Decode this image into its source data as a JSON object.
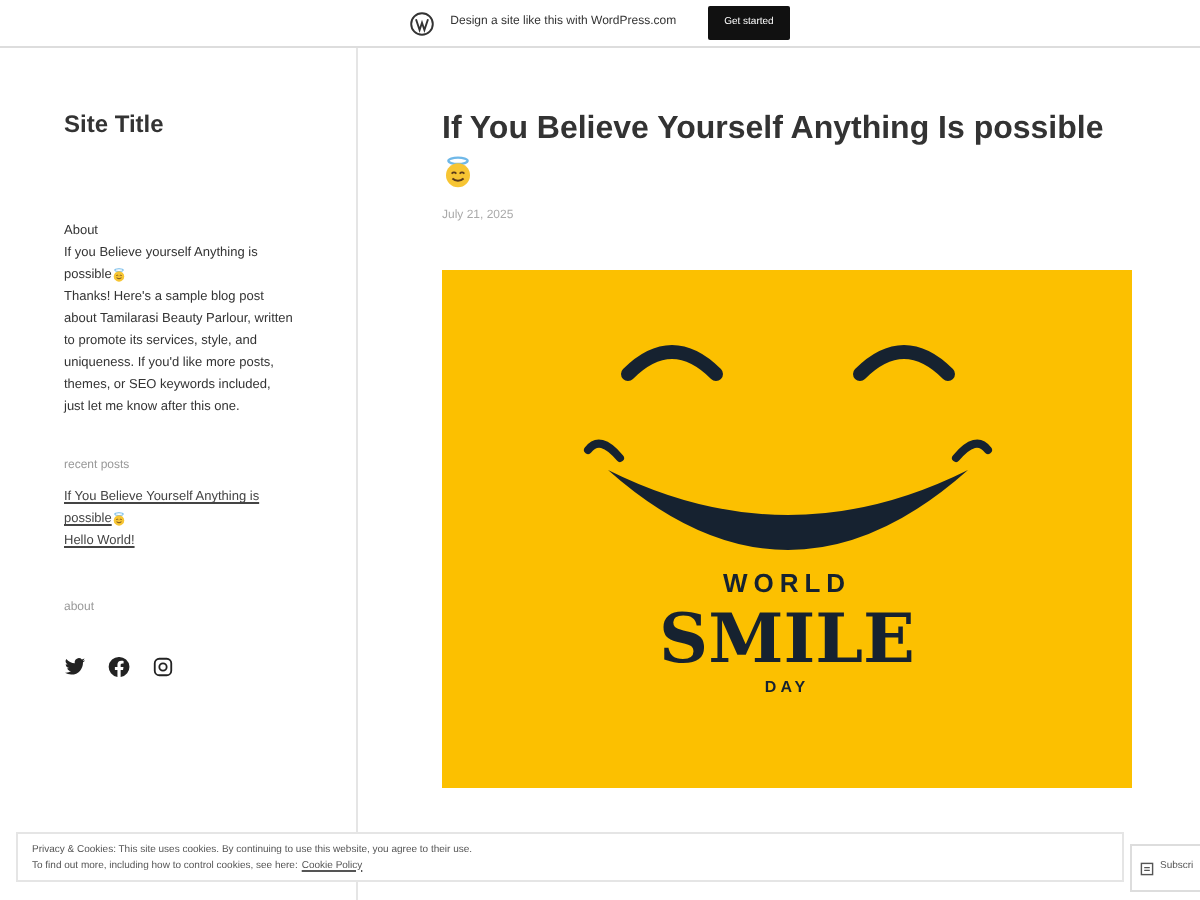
{
  "top_banner": {
    "text": "Design a site like this with WordPress.com",
    "button": "Get started"
  },
  "sidebar": {
    "site_title": "Site Title",
    "about_heading": "About",
    "about_post_title": "If you Believe yourself Anything is possible",
    "about_text": "Thanks! Here's a sample blog post about Tamilarasi Beauty Parlour, written to promote its services, style, and uniqueness. If you'd like more posts, themes, or SEO keywords included, just let me know after this one.",
    "recent_heading": "recent posts",
    "recent_posts": [
      {
        "title": "If You Believe Yourself Anything is possible",
        "emoji": true
      },
      {
        "title": "Hello World!",
        "emoji": false
      }
    ],
    "about_label": "about",
    "social": [
      {
        "kind": "twitter"
      },
      {
        "kind": "facebook"
      },
      {
        "kind": "instagram"
      }
    ]
  },
  "post": {
    "title": "If You Believe Yourself Anything Is possible",
    "date": "July 21, 2025",
    "image": {
      "line_1": "WORLD",
      "line_2": "SMILE",
      "line_3": "DAY"
    }
  },
  "cookie_banner": {
    "line_1": "Privacy & Cookies: This site uses cookies. By continuing to use this website, you agree to their use.",
    "line_2": "To find out more, including how to control cookies, see here:",
    "link": "Cookie Policy"
  },
  "subscribe_button": "Subscri"
}
